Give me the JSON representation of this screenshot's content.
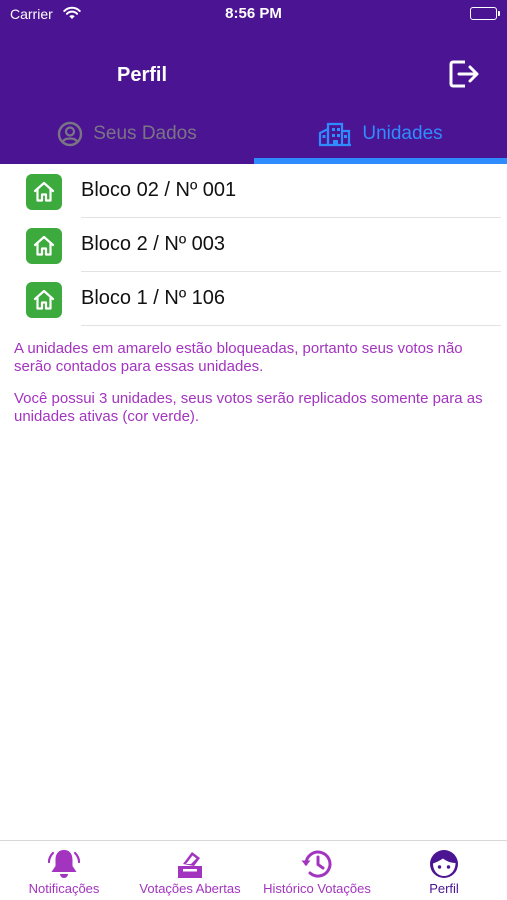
{
  "status_bar": {
    "carrier": "Carrier",
    "time": "8:56 PM"
  },
  "header": {
    "title": "Perfil",
    "logout_icon": "logout-icon"
  },
  "tabs": [
    {
      "label": "Seus Dados",
      "icon": "user-circle-icon",
      "active": false
    },
    {
      "label": "Unidades",
      "icon": "building-icon",
      "active": true
    }
  ],
  "units": [
    {
      "label": "Bloco 02 / Nº 001",
      "status_color": "#3daa3d"
    },
    {
      "label": "Bloco 2 / Nº 003",
      "status_color": "#3daa3d"
    },
    {
      "label": "Bloco 1 / Nº 106",
      "status_color": "#3daa3d"
    }
  ],
  "notes": {
    "blocked": "A unidades em amarelo estão bloqueadas, portanto seus votos não serão contados para essas unidades.",
    "summary": "Você possui 3 unidades, seus votos serão replicados somente para as unidades ativas (cor verde)."
  },
  "tabbar": [
    {
      "label": "Notificações",
      "icon": "bell-icon"
    },
    {
      "label": "Votações Abertas",
      "icon": "ballot-box-icon"
    },
    {
      "label": "Histórico Votações",
      "icon": "history-icon"
    },
    {
      "label": "Perfil",
      "icon": "profile-face-icon",
      "active": true
    }
  ],
  "colors": {
    "header": "#4b1492",
    "accent": "#2f8cff",
    "inactive_tab": "#7a7585",
    "unit_active": "#3daa3d",
    "note_text": "#a334c0"
  }
}
